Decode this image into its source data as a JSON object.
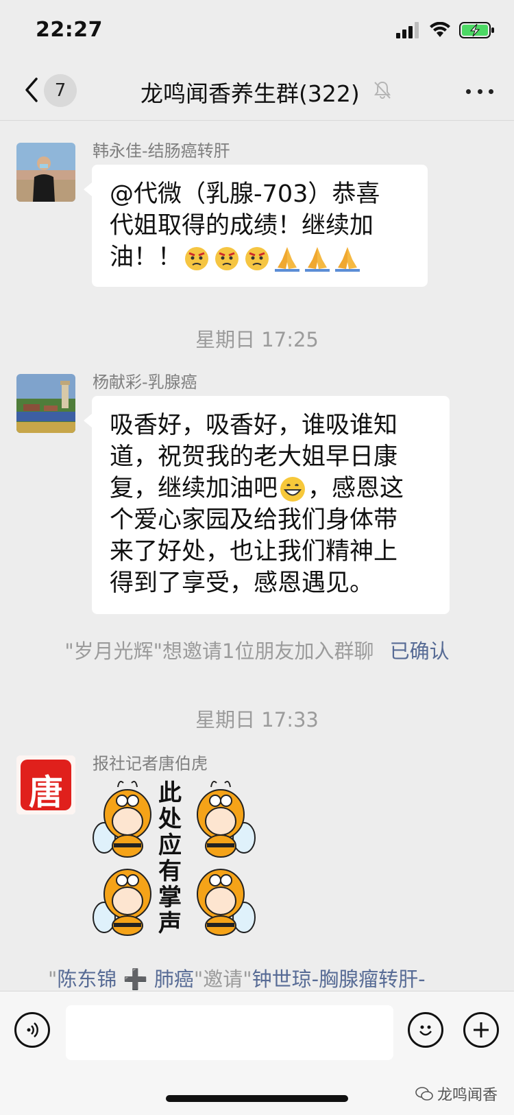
{
  "status_bar": {
    "time": "22:27"
  },
  "nav": {
    "back_count": "7",
    "title": "龙鸣闻香养生群(322)"
  },
  "messages": [
    {
      "sender": "韩永佳-结肠癌转肝",
      "lines": [
        "@代微（乳腺-703）恭喜",
        "代姐取得的成绩！继续加",
        "油！！"
      ],
      "emojis": [
        "angry-face",
        "angry-face",
        "angry-face",
        "folded-hands",
        "folded-hands",
        "folded-hands"
      ]
    },
    {
      "timestamp": "星期日 17:25"
    },
    {
      "sender": "杨献彩-乳腺癌",
      "lines": [
        "吸香好，吸香好，谁吸谁知",
        "道，祝贺我的老大姐早日康",
        "复，继续加油吧",
        "，感恩这",
        "个爱心家园及给我们身体带",
        "来了好处，也让我们精神上",
        "得到了享受，感恩遇见。"
      ]
    },
    {
      "system": "\"岁月光辉\"想邀请1位朋友加入群聊",
      "system_link": "已确认"
    },
    {
      "timestamp": "星期日 17:33"
    },
    {
      "sender": "报社记者唐伯虎",
      "sticker_text": [
        "此",
        "处",
        "应",
        "有",
        "掌",
        "声"
      ],
      "avatar_seal_text": "唐"
    },
    {
      "invite_prefix": "\"",
      "invite_name1": "陈东锦",
      "invite_symbol": "➕",
      "invite_name1b": "肺癌",
      "invite_mid": "\"邀请\"",
      "invite_name2": "钟世琼-胸腺瘤转肝-"
    }
  ],
  "watermark": "龙鸣闻香",
  "colors": {
    "background": "#ededed",
    "bubble": "#ffffff",
    "link": "#576b95",
    "battery": "#4cd964"
  }
}
